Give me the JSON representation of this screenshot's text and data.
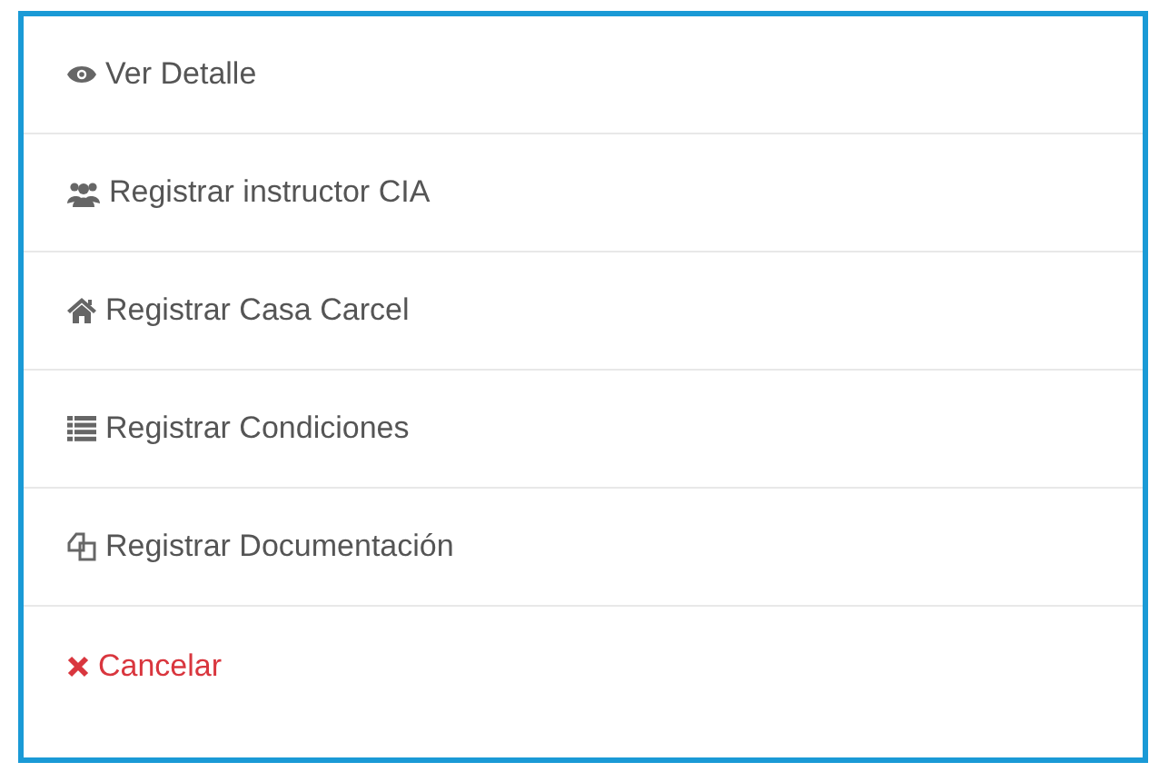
{
  "menu": {
    "items": [
      {
        "label": "Ver Detalle",
        "kind": "eye"
      },
      {
        "label": "Registrar instructor CIA",
        "kind": "users"
      },
      {
        "label": "Registrar Casa Carcel",
        "kind": "home"
      },
      {
        "label": "Registrar Condiciones",
        "kind": "list"
      },
      {
        "label": "Registrar Documentación",
        "kind": "copy"
      },
      {
        "label": "Cancelar",
        "kind": "cancel"
      }
    ]
  }
}
